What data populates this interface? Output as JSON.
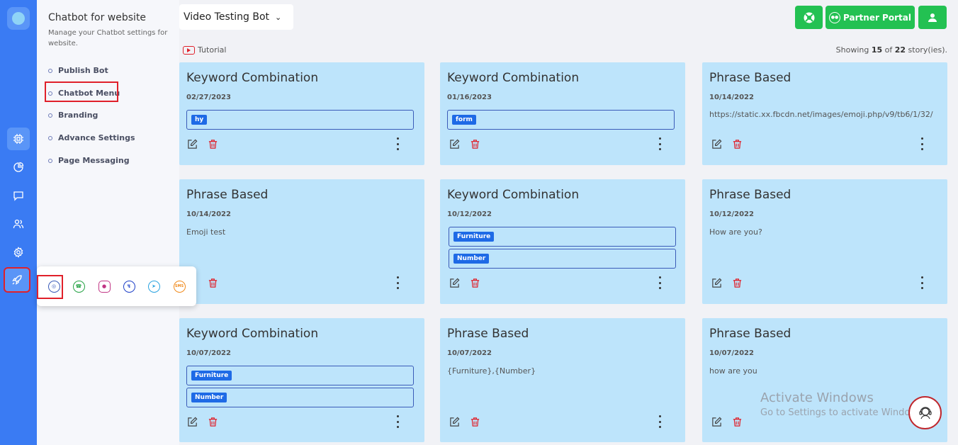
{
  "sidebar_panel": {
    "title": "Chatbot for website",
    "subtitle": "Manage your Chatbot settings for website.",
    "items": [
      "Publish Bot",
      "Chatbot Menu",
      "Branding",
      "Advance Settings",
      "Page Messaging"
    ]
  },
  "rail_icons": [
    "app-logo-icon",
    "cpu-icon",
    "pie-chart-icon",
    "chat-icon",
    "users-icon",
    "gear-icon",
    "rocket-icon"
  ],
  "channels": [
    "web-icon",
    "whatsapp-icon",
    "instagram-icon",
    "messenger-icon",
    "telegram-icon",
    "sms-icon"
  ],
  "header": {
    "bot_name": "Video Testing Bot",
    "partner_portal": "Partner Portal",
    "tutorial": "Tutorial",
    "showing_prefix": "Showing ",
    "showing_count": "15",
    "showing_mid": " of ",
    "showing_total": "22",
    "showing_suffix": " story(ies).",
    "accent_color": "#23c152"
  },
  "cards": [
    {
      "title": "Keyword Combination",
      "date": "02/27/2023",
      "keywords": [
        "hy"
      ]
    },
    {
      "title": "Keyword Combination",
      "date": "01/16/2023",
      "keywords": [
        "form"
      ]
    },
    {
      "title": "Phrase Based",
      "date": "10/14/2022",
      "text": "https://static.xx.fbcdn.net/images/emoji.php/v9/tb6/1/32/"
    },
    {
      "title": "Phrase Based",
      "date": "10/14/2022",
      "text": "Emoji test"
    },
    {
      "title": "Keyword Combination",
      "date": "10/12/2022",
      "keywords": [
        "Furniture",
        "Number"
      ]
    },
    {
      "title": "Phrase Based",
      "date": "10/12/2022",
      "text": "How are you?"
    },
    {
      "title": "Keyword Combination",
      "date": "10/07/2022",
      "keywords": [
        "Furniture",
        "Number"
      ]
    },
    {
      "title": "Phrase Based",
      "date": "10/07/2022",
      "text": "{Furniture},{Number}"
    },
    {
      "title": "Phrase Based",
      "date": "10/07/2022",
      "text": "how are you"
    }
  ],
  "watermark": {
    "line1": "Activate Windows",
    "line2": "Go to Settings to activate Windows."
  }
}
